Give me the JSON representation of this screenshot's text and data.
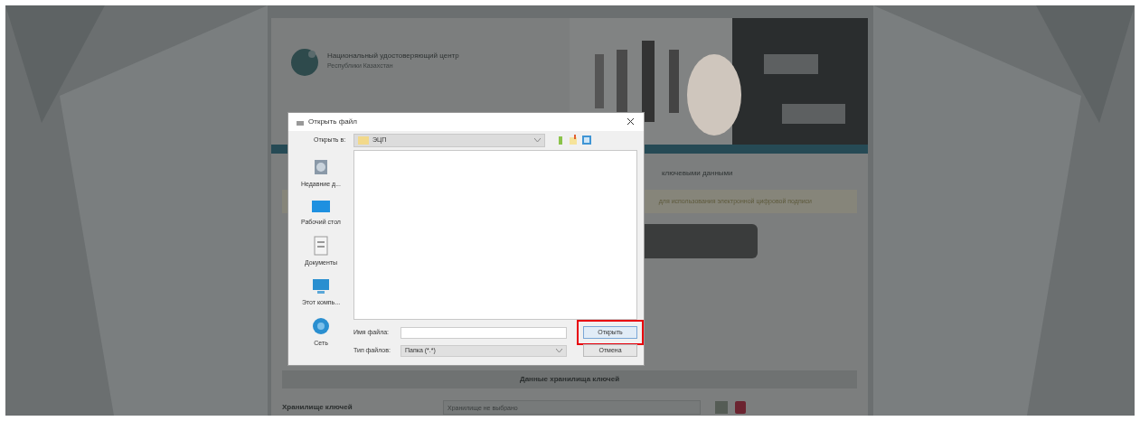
{
  "site": {
    "title": "Национальный удостоверяющий центр",
    "subtitle": "Республики Казахстан"
  },
  "page": {
    "heading_fragment": "ключевыми данными",
    "notice_fragment": "для использования электронной цифровой подписи",
    "section_title": "Данные хранилища ключей",
    "store_label": "Хранилище ключей",
    "store_placeholder": "Хранилище не выбрано"
  },
  "dialog": {
    "title": "Открыть файл",
    "look_in_label": "Открыть в:",
    "folder": "ЭЦП",
    "places": [
      {
        "kind": "recent",
        "label": "Недавние д..."
      },
      {
        "kind": "desktop",
        "label": "Рабочий стол"
      },
      {
        "kind": "documents",
        "label": "Документы"
      },
      {
        "kind": "computer",
        "label": "Этот компь..."
      },
      {
        "kind": "network",
        "label": "Сеть"
      }
    ],
    "file_name_label": "Имя файла:",
    "file_type_label": "Тип файлов:",
    "file_type": "Папка (*.*)",
    "buttons": [
      {
        "label": "Открыть",
        "highlighted": true
      },
      {
        "label": "Отмена",
        "highlighted": false
      }
    ]
  }
}
